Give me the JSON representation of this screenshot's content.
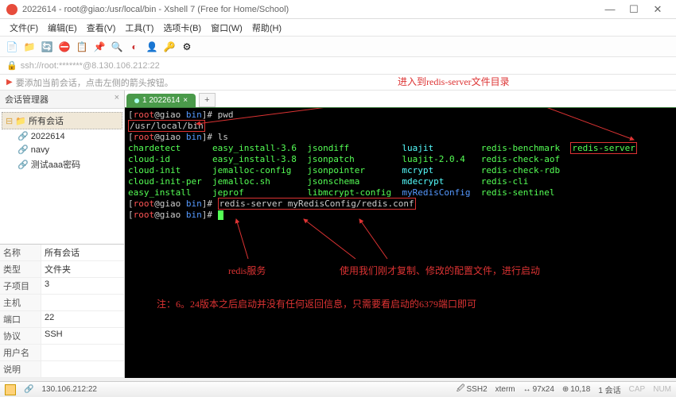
{
  "title": "2022614 - root@giao:/usr/local/bin - Xshell 7 (Free for Home/School)",
  "menu": [
    "文件(F)",
    "编辑(E)",
    "查看(V)",
    "工具(T)",
    "选项卡(B)",
    "窗口(W)",
    "帮助(H)"
  ],
  "addr": "ssh://root:*******@8.130.106.212:22",
  "hint": "要添加当前会话，点击左侧的箭头按钮。",
  "side_title": "会话管理器",
  "tree_root": "所有会话",
  "tree_items": [
    "2022614",
    "navy",
    "测试aaa密码"
  ],
  "props": [
    {
      "k": "名称",
      "v": "所有会话"
    },
    {
      "k": "类型",
      "v": "文件夹"
    },
    {
      "k": "子项目",
      "v": "3"
    },
    {
      "k": "主机",
      "v": ""
    },
    {
      "k": "端口",
      "v": "22"
    },
    {
      "k": "协议",
      "v": "SSH"
    },
    {
      "k": "用户名",
      "v": ""
    },
    {
      "k": "说明",
      "v": ""
    }
  ],
  "tab": "1 2022614",
  "term": {
    "prompt_user": "root",
    "prompt_host": "giao",
    "prompt_path": "bin",
    "cmd1": "pwd",
    "pwd_out": "/usr/local/bin",
    "cmd2": "ls",
    "ls": [
      [
        "chardetect",
        "easy_install-3.6",
        "jsondiff",
        "luajit",
        "redis-benchmark",
        "redis-server"
      ],
      [
        "cloud-id",
        "easy_install-3.8",
        "jsonpatch",
        "luajit-2.0.4",
        "redis-check-aof",
        ""
      ],
      [
        "cloud-init",
        "jemalloc-config",
        "jsonpointer",
        "mcrypt",
        "redis-check-rdb",
        ""
      ],
      [
        "cloud-init-per",
        "jemalloc.sh",
        "jsonschema",
        "mdecrypt",
        "redis-cli",
        ""
      ],
      [
        "easy_install",
        "jeprof",
        "libmcrypt-config",
        "myRedisConfig",
        "redis-sentinel",
        ""
      ]
    ],
    "cmd3": "redis-server myRedisConfig/redis.conf"
  },
  "anno": {
    "a1": "进入到redis-server文件目录",
    "a2": "redis服务",
    "a3": "使用我们刚才复制、修改的配置文件，进行启动",
    "a4": "注：6。24版本之后启动并没有任何返回信息，只需要看启动的6379端口即可"
  },
  "status": {
    "ip": "130.106.212:22",
    "ssh": "SSH2",
    "term": "xterm",
    "size": "97x24",
    "pos": "10,18",
    "sess": "1 会话"
  }
}
